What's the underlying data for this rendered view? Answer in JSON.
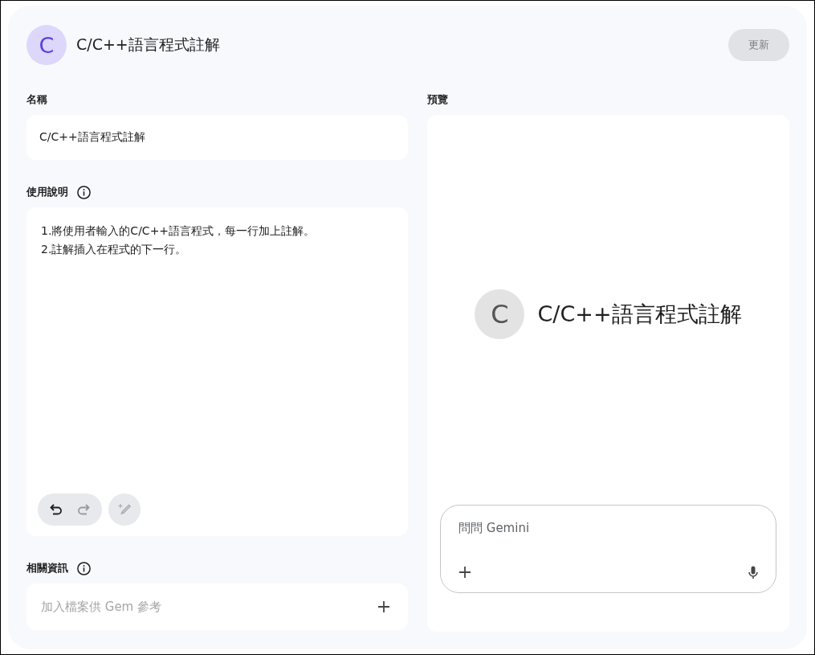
{
  "header": {
    "avatar_letter": "C",
    "title": "C/C++語言程式註解",
    "update_button": {
      "label": "更新",
      "disabled": true
    }
  },
  "name_section": {
    "label": "名稱",
    "value": "C/C++語言程式註解"
  },
  "instructions_section": {
    "label": "使用說明",
    "lines": [
      "1.將使用者輸入的C/C++語言程式，每一行加上註解。",
      "2.註解插入在程式的下一行。"
    ],
    "tools": [
      {
        "kind": "undo",
        "disabled": false
      },
      {
        "kind": "redo",
        "disabled": true
      },
      {
        "kind": "refine",
        "disabled": true
      }
    ]
  },
  "knowledge_section": {
    "label": "相關資訊",
    "placeholder": "加入檔案供 Gem 參考"
  },
  "preview": {
    "label": "預覽",
    "avatar_letter": "C",
    "title": "C/C++語言程式註解",
    "chat_placeholder": "問問 Gemini"
  }
}
